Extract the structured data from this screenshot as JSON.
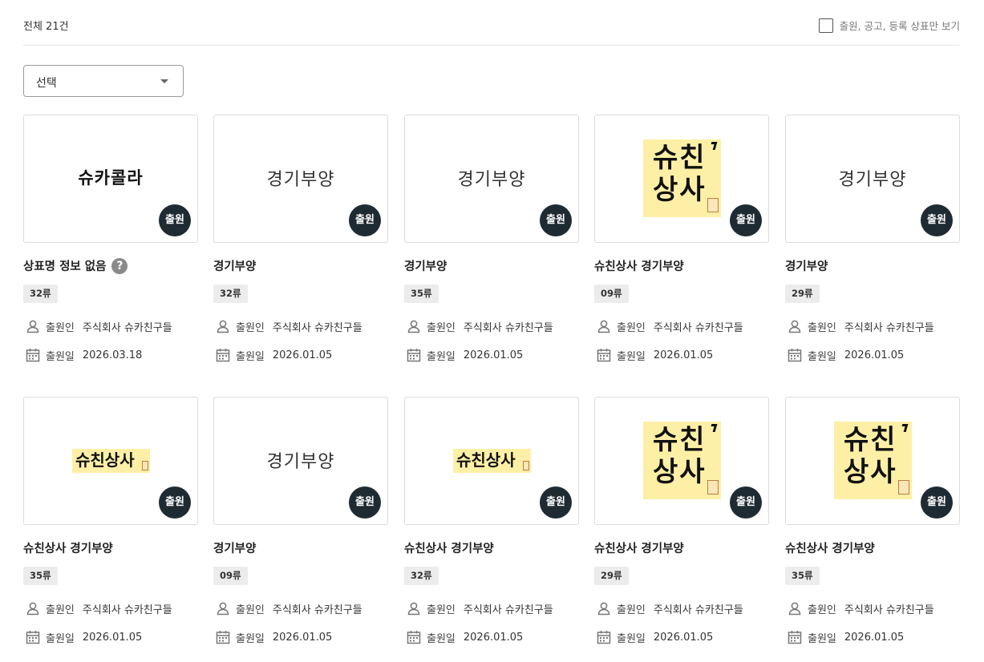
{
  "header": {
    "total_label": "전체 21건",
    "filter_label": "출원, 공고, 등록 상표만 보기",
    "filter_checked": false
  },
  "select": {
    "value": "선택"
  },
  "labels": {
    "status": "출원",
    "applicant": "출원인",
    "date": "출원일",
    "help": "?"
  },
  "cards": [
    {
      "thumb": {
        "type": "text-bold",
        "text": "슈카콜라"
      },
      "title": "상표명 정보 없음",
      "has_help": true,
      "class": "32류",
      "applicant": "주식회사 슈카친구들",
      "date": "2026.03.18"
    },
    {
      "thumb": {
        "type": "text",
        "text": "경기부양"
      },
      "title": "경기부양",
      "has_help": false,
      "class": "32류",
      "applicant": "주식회사 슈카친구들",
      "date": "2026.01.05"
    },
    {
      "thumb": {
        "type": "text",
        "text": "경기부양"
      },
      "title": "경기부양",
      "has_help": false,
      "class": "35류",
      "applicant": "주식회사 슈카친구들",
      "date": "2026.01.05"
    },
    {
      "thumb": {
        "type": "logo-big",
        "line1": "슈친",
        "line2": "상사"
      },
      "title": "슈친상사 경기부양",
      "has_help": false,
      "class": "09류",
      "applicant": "주식회사 슈카친구들",
      "date": "2026.01.05"
    },
    {
      "thumb": {
        "type": "text",
        "text": "경기부양"
      },
      "title": "경기부양",
      "has_help": false,
      "class": "29류",
      "applicant": "주식회사 슈카친구들",
      "date": "2026.01.05"
    },
    {
      "thumb": {
        "type": "logo-wide",
        "text": "슈친상사"
      },
      "title": "슈친상사 경기부양",
      "has_help": false,
      "class": "35류",
      "applicant": "주식회사 슈카친구들",
      "date": "2026.01.05"
    },
    {
      "thumb": {
        "type": "text",
        "text": "경기부양"
      },
      "title": "경기부양",
      "has_help": false,
      "class": "09류",
      "applicant": "주식회사 슈카친구들",
      "date": "2026.01.05"
    },
    {
      "thumb": {
        "type": "logo-wide",
        "text": "슈친상사"
      },
      "title": "슈친상사 경기부양",
      "has_help": false,
      "class": "32류",
      "applicant": "주식회사 슈카친구들",
      "date": "2026.01.05"
    },
    {
      "thumb": {
        "type": "logo-big",
        "line1": "슈친",
        "line2": "상사"
      },
      "title": "슈친상사 경기부양",
      "has_help": false,
      "class": "29류",
      "applicant": "주식회사 슈카친구들",
      "date": "2026.01.05"
    },
    {
      "thumb": {
        "type": "logo-big",
        "line1": "슈친",
        "line2": "상사"
      },
      "title": "슈친상사 경기부양",
      "has_help": false,
      "class": "35류",
      "applicant": "주식회사 슈카친구들",
      "date": "2026.01.05"
    }
  ]
}
